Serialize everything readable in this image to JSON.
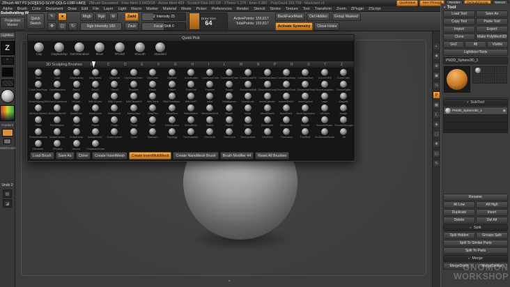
{
  "title_bar": {
    "app_title": "ZBrush 4R7 P2 [x32][ESQ-SLVP-QQLG-L08F-HM3]",
    "doc_title": "ZBrush Document",
    "stats": "Free Mem 3.6431GB · Active Mem 453 · Scratch Disk 163 GB · ZTimes 1.276 · timer 6.881 · PolyCount 159,759 · MaxUsed x1",
    "right_buttons": [
      {
        "label": "QuickSave",
        "style": "orange"
      },
      {
        "label": "See-Through",
        "style": "orange"
      },
      {
        "label": "Render",
        "style": "dark"
      },
      {
        "label": "DefaultZScript",
        "style": "orange"
      },
      {
        "label": "Menus",
        "style": "dark"
      }
    ]
  },
  "menu_bar": {
    "items": [
      "Alpha",
      "Brush",
      "Color",
      "Document",
      "Draw",
      "Edit",
      "File",
      "Layer",
      "Light",
      "Macro",
      "Marker",
      "Material",
      "Movie",
      "Picker",
      "Preferences",
      "Render",
      "Stencil",
      "Stroke",
      "Texture",
      "Tool",
      "Transform",
      "Zoom",
      "ZPlugin",
      "ZScript"
    ]
  },
  "overlay": {
    "tutorial_note": "Subdividing W..."
  },
  "shelf": {
    "quick_sketch": "Quick Sketch",
    "mode_icons": [
      {
        "name": "edit-mode-icon",
        "glyph": "✎"
      },
      {
        "name": "draw-mode-icon",
        "glyph": "●",
        "active": true
      },
      {
        "name": "move-mode-icon",
        "glyph": "✥"
      },
      {
        "name": "scale-mode-icon",
        "glyph": "◱"
      },
      {
        "name": "rotate-mode-icon",
        "glyph": "↻"
      }
    ],
    "paint_modes": [
      {
        "label": "Mrgb"
      },
      {
        "label": "Rgb"
      },
      {
        "label": "M"
      }
    ],
    "sculpt_modes": [
      {
        "label": "Zadd",
        "active": true
      },
      {
        "label": "Zsub"
      }
    ],
    "sliders": {
      "rgb_intensity": "Rgb Intensity 100",
      "z_intensity": "Z Intensity 25",
      "focal_shift": "Focal Shift 0",
      "draw_size_label": "Draw Size",
      "draw_size_value": "64"
    },
    "counters": {
      "active": "ActivePoints: 159,817",
      "total": "TotalPoints: 159,817"
    },
    "right_rows": [
      [
        {
          "label": "BackFaceMask"
        },
        {
          "label": "Del Hidden"
        },
        {
          "label": "Group Masked"
        }
      ],
      [
        {
          "label": "Activate Symmetry",
          "style": "orange"
        },
        {
          "label": "Close Holes"
        }
      ]
    ]
  },
  "left_shelf": {
    "lightbox": "Lightbox",
    "projection_master": "Projection Master",
    "gradient": "Gradient",
    "switch_color": "SwitchColor",
    "undo": "Undo 2",
    "corner_icons": [
      {
        "name": "script-icon",
        "glyph": "▤"
      },
      {
        "name": "note-icon",
        "glyph": "◪"
      }
    ]
  },
  "canvas": {
    "dock_marker": "▴"
  },
  "brush_popup": {
    "quick_pick_title": "Quick Pick",
    "quick_pick": [
      "Clay",
      "ClayBuildup",
      "DamStandard",
      "Move",
      "hPolish",
      "Smooth",
      "Standard"
    ],
    "section_title": "3D Sculpting Brushes",
    "letters": [
      "B",
      "C",
      "D",
      "E",
      "F",
      "G",
      "H",
      "I",
      "L",
      "M",
      "N",
      "P",
      "R",
      "S",
      "T",
      "Z"
    ],
    "rows": [
      [
        "Blob",
        "Clay",
        "ClayBuildup",
        "ClayTubes",
        "ClipCircle",
        "ClipCircleCenter",
        "ClipCurve",
        "ClipRect",
        "CurveLathe",
        "CurveLineTube",
        "CurveMultiTube",
        "CurveQuadFill",
        "CurveStandard",
        "CurveStrapSnap",
        "CurveSurface",
        "CurveTriFill",
        "CurveTube"
      ],
      [
        "CurveTubeSnap",
        "DamStandard",
        "Deco1",
        "Deco2",
        "Deco3",
        "Displace",
        "Elastic",
        "Flakes",
        "FormSoft",
        "Fracture",
        "Gouge",
        "GroomHairBall",
        "GroomHairLong",
        "GroomHairShort",
        "GroomHairToss",
        "GroomLengthen",
        "GroomSpike"
      ],
      [
        "GroomStrongTilt",
        "GroomTurbulence",
        "hPolish",
        "IMM BParts",
        "IMM Curves",
        "IMM ModelKit",
        "IMM Parts",
        "IMM Primitives",
        "IMM SciFi",
        "Inflat",
        "InflatBalloon",
        "InsertCube",
        "InsertCylinder",
        "InsertHRelief",
        "InsertSphere",
        "Layer",
        "Magnify"
      ],
      [
        "MAHcut MechA",
        "MAHcut MechB",
        "MalletFast",
        "MaskCircle",
        "MaskCurve",
        "MaskLasso",
        "MaskPen",
        "MaskRect",
        "MatchMaker",
        "MeshInsertDot",
        "Morph",
        "Move",
        "MoveElastic",
        "MoveParts",
        "MoveTopological",
        "mPolish",
        "Nudge"
      ],
      [
        "PenA",
        "PenShadow",
        "Pinch",
        "Planar",
        "Polish",
        "Pump",
        "Rake",
        "SelectLasso",
        "SelectRect",
        "Slash1",
        "Slash2",
        "Slash3",
        "SliceCircle",
        "SliceCurve",
        "Smooth",
        "SmoothPeaks",
        "SmoothStronger"
      ],
      [
        "SmoothValence",
        "SnakeCactus",
        "SnakeHook",
        "SnakeHook2",
        "SnakeSphere",
        "Spiral",
        "Standard",
        "Topology",
        "TrimAdaptive",
        "TrimCircle",
        "TrimCurve",
        "TrimDynamic",
        "TrimFront",
        "TrimLasso",
        "TrimRect",
        "TrimSmoothBorder",
        "Tilt"
      ],
      [
        "ZModeler",
        "ZProject",
        "Wound",
        "CharacterGuide"
      ]
    ],
    "footer_buttons": [
      {
        "label": "Load Brush"
      },
      {
        "label": "Save As"
      },
      {
        "label": "Clone"
      },
      {
        "label": "Create InsertMesh"
      },
      {
        "label": "Create InsertMultiMesh",
        "style": "orange"
      },
      {
        "label": "Create NanoMesh Brush"
      },
      {
        "label": "Brush Modifier 44"
      },
      {
        "label": "Reset All Brushes"
      }
    ]
  },
  "right_shelf": {
    "icons": [
      {
        "name": "bpr-icon",
        "glyph": "◐"
      },
      {
        "name": "scroll-icon",
        "glyph": "✚"
      },
      {
        "name": "zoom-icon",
        "glyph": "⊕"
      },
      {
        "name": "actual-size-icon",
        "glyph": "▣"
      },
      {
        "name": "aa-half-icon",
        "glyph": "½"
      },
      {
        "name": "persp-icon",
        "glyph": "P",
        "active": true
      },
      {
        "name": "floor-icon",
        "glyph": "▦"
      },
      {
        "name": "local-icon",
        "glyph": "L"
      },
      {
        "name": "lsym-icon",
        "glyph": "◈"
      },
      {
        "name": "frame-icon",
        "glyph": "▢"
      },
      {
        "name": "move-icon",
        "glyph": "✥"
      },
      {
        "name": "scale-icon",
        "glyph": "◱"
      },
      {
        "name": "rotate-icon",
        "glyph": "↻"
      }
    ]
  },
  "tool_palette": {
    "title": "Tool",
    "rows": [
      [
        "Load Tool",
        "Save As"
      ],
      [
        "Copy Tool",
        "Paste Tool"
      ],
      [
        "Import",
        "Export"
      ],
      [
        "Clone",
        "Make PolyMesh3D"
      ],
      [
        "GoZ",
        "All",
        "Visible"
      ],
      [
        "Lightbox>Tools"
      ]
    ],
    "active_tool_name": "PM3D_Sphere3D_1",
    "subtool": {
      "title": "SubTool",
      "items": [
        "PM3D_Sphere3D_1"
      ],
      "button_rows": [
        [
          "Rename"
        ],
        [
          "All Low",
          "All High"
        ],
        [
          "Duplicate",
          "Insert"
        ],
        [
          "Delete",
          "Del All"
        ]
      ],
      "split_title": "Split",
      "split_rows": [
        [
          "Split Hidden",
          "Groups Split"
        ],
        [
          "Split To Similar Parts"
        ],
        [
          "Split To Parts"
        ]
      ],
      "merge_title": "Merge",
      "merge_rows": [
        [
          "MergeDown",
          "MergeSimilar"
        ]
      ]
    }
  },
  "watermark": {
    "line1": "GNOMON",
    "line2": "WORKSHOP"
  }
}
